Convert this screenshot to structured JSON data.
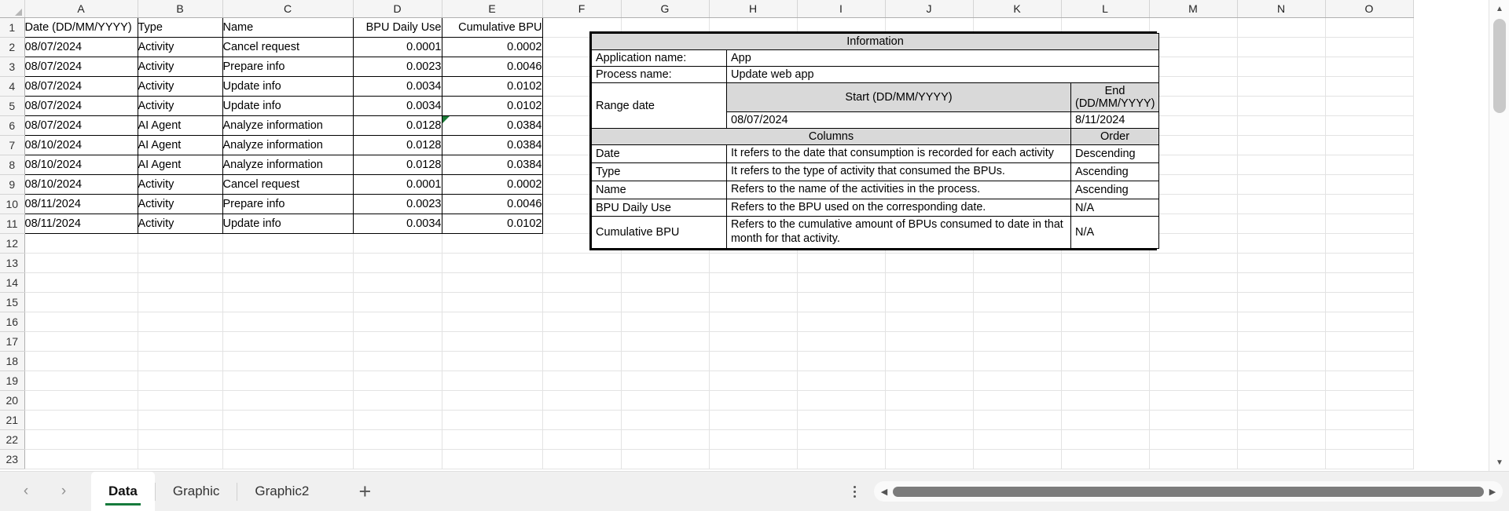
{
  "grid": {
    "column_headers": [
      "A",
      "B",
      "C",
      "D",
      "E",
      "F",
      "G",
      "H",
      "I",
      "J",
      "K",
      "L",
      "M",
      "N",
      "O"
    ],
    "row_numbers": [
      "1",
      "2",
      "3",
      "4",
      "5",
      "6",
      "7",
      "8",
      "9",
      "10",
      "11",
      "12",
      "13",
      "14",
      "15",
      "16",
      "17",
      "18",
      "19",
      "20",
      "21",
      "22",
      "23"
    ]
  },
  "data_table": {
    "headers": [
      "Date (DD/MM/YYYY)",
      "Type",
      "Name",
      "BPU Daily Use",
      "Cumulative BPU"
    ],
    "rows": [
      [
        "08/07/2024",
        "Activity",
        "Cancel request",
        "0.0001",
        "0.0002"
      ],
      [
        "08/07/2024",
        "Activity",
        "Prepare info",
        "0.0023",
        "0.0046"
      ],
      [
        "08/07/2024",
        "Activity",
        "Update info",
        "0.0034",
        "0.0102"
      ],
      [
        "08/07/2024",
        "Activity",
        "Update info",
        "0.0034",
        "0.0102"
      ],
      [
        "08/07/2024",
        "AI Agent",
        "Analyze information",
        "0.0128",
        "0.0384"
      ],
      [
        "08/10/2024",
        "AI Agent",
        "Analyze information",
        "0.0128",
        "0.0384"
      ],
      [
        "08/10/2024",
        "AI Agent",
        "Analyze information",
        "0.0128",
        "0.0384"
      ],
      [
        "08/10/2024",
        "Activity",
        "Cancel request",
        "0.0001",
        "0.0002"
      ],
      [
        "08/11/2024",
        "Activity",
        "Prepare info",
        "0.0023",
        "0.0046"
      ],
      [
        "08/11/2024",
        "Activity",
        "Update info",
        "0.0034",
        "0.0102"
      ]
    ]
  },
  "info_panel": {
    "title": "Information",
    "application_name_label": "Application name:",
    "application_name_value": "App",
    "process_name_label": "Process name:",
    "process_name_value": "Update web app",
    "range_date_label": "Range date",
    "start_header": "Start (DD/MM/YYYY)",
    "end_header": "End (DD/MM/YYYY)",
    "start_value": "08/07/2024",
    "end_value": "8/11/2024",
    "columns_title": "Columns",
    "order_title": "Order",
    "column_rows": [
      {
        "name": "Date",
        "description": "It refers to the date that consumption is recorded for each activity",
        "order": "Descending"
      },
      {
        "name": "Type",
        "description": "It refers to the type of activity that consumed the BPUs.",
        "order": "Ascending"
      },
      {
        "name": "Name",
        "description": "Refers to the name of the activities in the process.",
        "order": "Ascending"
      },
      {
        "name": "BPU Daily Use",
        "description": "Refers to the BPU used on the corresponding date.",
        "order": "N/A"
      },
      {
        "name": "Cumulative BPU",
        "description": "Refers to the cumulative amount of BPUs consumed to date in that month for that activity.",
        "order": "N/A"
      }
    ]
  },
  "sheet_tabs": {
    "prev_label": "‹",
    "next_label": "›",
    "add_label": "+",
    "tabs": [
      {
        "label": "Data",
        "active": true
      },
      {
        "label": "Graphic",
        "active": false
      },
      {
        "label": "Graphic2",
        "active": false
      }
    ]
  },
  "scrollbars": {
    "v_up": "▲",
    "v_down": "▼",
    "h_left": "◀",
    "h_right": "▶"
  },
  "colors": {
    "header_fill": "#d9d9d9",
    "tab_accent": "#167a3c",
    "flag_green": "#1a7a37",
    "gridline": "#e3e3e3"
  }
}
